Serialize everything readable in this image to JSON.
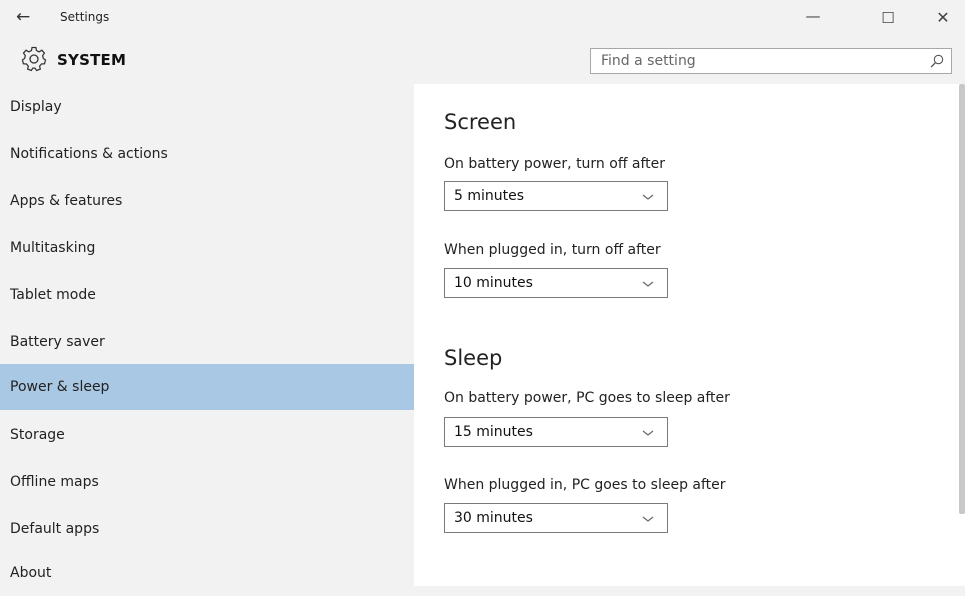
{
  "window": {
    "title": "Settings",
    "back_icon": "←",
    "minimize_icon": "—",
    "maximize_icon": "☐",
    "close_icon": "✕"
  },
  "header": {
    "icon": "gear-icon",
    "title": "SYSTEM"
  },
  "search": {
    "placeholder": "Find a setting",
    "icon": "search-icon"
  },
  "sidebar": {
    "selected_color": "#a9c8e3",
    "items": [
      {
        "label": "Display"
      },
      {
        "label": "Notifications & actions"
      },
      {
        "label": "Apps & features"
      },
      {
        "label": "Multitasking"
      },
      {
        "label": "Tablet mode"
      },
      {
        "label": "Battery saver"
      },
      {
        "label": "Power & sleep",
        "selected": true
      },
      {
        "label": "Storage"
      },
      {
        "label": "Offline maps"
      },
      {
        "label": "Default apps"
      },
      {
        "label": "About"
      }
    ]
  },
  "main": {
    "screen": {
      "heading": "Screen",
      "battery_label": "On battery power, turn off after",
      "battery_value": "5 minutes",
      "plugged_label": "When plugged in, turn off after",
      "plugged_value": "10 minutes"
    },
    "sleep": {
      "heading": "Sleep",
      "battery_label": "On battery power, PC goes to sleep after",
      "battery_value": "15 minutes",
      "plugged_label": "When plugged in, PC goes to sleep after",
      "plugged_value": "30 minutes"
    }
  }
}
